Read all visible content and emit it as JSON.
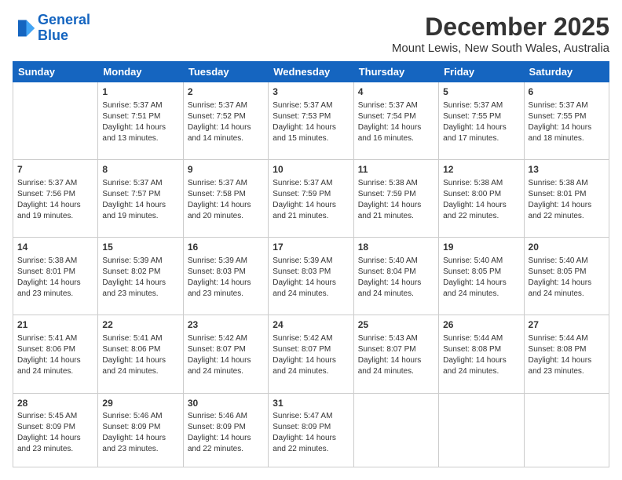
{
  "logo": {
    "line1": "General",
    "line2": "Blue"
  },
  "title": "December 2025",
  "location": "Mount Lewis, New South Wales, Australia",
  "weekdays": [
    "Sunday",
    "Monday",
    "Tuesday",
    "Wednesday",
    "Thursday",
    "Friday",
    "Saturday"
  ],
  "weeks": [
    [
      {
        "day": "",
        "text": ""
      },
      {
        "day": "1",
        "text": "Sunrise: 5:37 AM\nSunset: 7:51 PM\nDaylight: 14 hours\nand 13 minutes."
      },
      {
        "day": "2",
        "text": "Sunrise: 5:37 AM\nSunset: 7:52 PM\nDaylight: 14 hours\nand 14 minutes."
      },
      {
        "day": "3",
        "text": "Sunrise: 5:37 AM\nSunset: 7:53 PM\nDaylight: 14 hours\nand 15 minutes."
      },
      {
        "day": "4",
        "text": "Sunrise: 5:37 AM\nSunset: 7:54 PM\nDaylight: 14 hours\nand 16 minutes."
      },
      {
        "day": "5",
        "text": "Sunrise: 5:37 AM\nSunset: 7:55 PM\nDaylight: 14 hours\nand 17 minutes."
      },
      {
        "day": "6",
        "text": "Sunrise: 5:37 AM\nSunset: 7:55 PM\nDaylight: 14 hours\nand 18 minutes."
      }
    ],
    [
      {
        "day": "7",
        "text": "Sunrise: 5:37 AM\nSunset: 7:56 PM\nDaylight: 14 hours\nand 19 minutes."
      },
      {
        "day": "8",
        "text": "Sunrise: 5:37 AM\nSunset: 7:57 PM\nDaylight: 14 hours\nand 19 minutes."
      },
      {
        "day": "9",
        "text": "Sunrise: 5:37 AM\nSunset: 7:58 PM\nDaylight: 14 hours\nand 20 minutes."
      },
      {
        "day": "10",
        "text": "Sunrise: 5:37 AM\nSunset: 7:59 PM\nDaylight: 14 hours\nand 21 minutes."
      },
      {
        "day": "11",
        "text": "Sunrise: 5:38 AM\nSunset: 7:59 PM\nDaylight: 14 hours\nand 21 minutes."
      },
      {
        "day": "12",
        "text": "Sunrise: 5:38 AM\nSunset: 8:00 PM\nDaylight: 14 hours\nand 22 minutes."
      },
      {
        "day": "13",
        "text": "Sunrise: 5:38 AM\nSunset: 8:01 PM\nDaylight: 14 hours\nand 22 minutes."
      }
    ],
    [
      {
        "day": "14",
        "text": "Sunrise: 5:38 AM\nSunset: 8:01 PM\nDaylight: 14 hours\nand 23 minutes."
      },
      {
        "day": "15",
        "text": "Sunrise: 5:39 AM\nSunset: 8:02 PM\nDaylight: 14 hours\nand 23 minutes."
      },
      {
        "day": "16",
        "text": "Sunrise: 5:39 AM\nSunset: 8:03 PM\nDaylight: 14 hours\nand 23 minutes."
      },
      {
        "day": "17",
        "text": "Sunrise: 5:39 AM\nSunset: 8:03 PM\nDaylight: 14 hours\nand 24 minutes."
      },
      {
        "day": "18",
        "text": "Sunrise: 5:40 AM\nSunset: 8:04 PM\nDaylight: 14 hours\nand 24 minutes."
      },
      {
        "day": "19",
        "text": "Sunrise: 5:40 AM\nSunset: 8:05 PM\nDaylight: 14 hours\nand 24 minutes."
      },
      {
        "day": "20",
        "text": "Sunrise: 5:40 AM\nSunset: 8:05 PM\nDaylight: 14 hours\nand 24 minutes."
      }
    ],
    [
      {
        "day": "21",
        "text": "Sunrise: 5:41 AM\nSunset: 8:06 PM\nDaylight: 14 hours\nand 24 minutes."
      },
      {
        "day": "22",
        "text": "Sunrise: 5:41 AM\nSunset: 8:06 PM\nDaylight: 14 hours\nand 24 minutes."
      },
      {
        "day": "23",
        "text": "Sunrise: 5:42 AM\nSunset: 8:07 PM\nDaylight: 14 hours\nand 24 minutes."
      },
      {
        "day": "24",
        "text": "Sunrise: 5:42 AM\nSunset: 8:07 PM\nDaylight: 14 hours\nand 24 minutes."
      },
      {
        "day": "25",
        "text": "Sunrise: 5:43 AM\nSunset: 8:07 PM\nDaylight: 14 hours\nand 24 minutes."
      },
      {
        "day": "26",
        "text": "Sunrise: 5:44 AM\nSunset: 8:08 PM\nDaylight: 14 hours\nand 24 minutes."
      },
      {
        "day": "27",
        "text": "Sunrise: 5:44 AM\nSunset: 8:08 PM\nDaylight: 14 hours\nand 23 minutes."
      }
    ],
    [
      {
        "day": "28",
        "text": "Sunrise: 5:45 AM\nSunset: 8:09 PM\nDaylight: 14 hours\nand 23 minutes."
      },
      {
        "day": "29",
        "text": "Sunrise: 5:46 AM\nSunset: 8:09 PM\nDaylight: 14 hours\nand 23 minutes."
      },
      {
        "day": "30",
        "text": "Sunrise: 5:46 AM\nSunset: 8:09 PM\nDaylight: 14 hours\nand 22 minutes."
      },
      {
        "day": "31",
        "text": "Sunrise: 5:47 AM\nSunset: 8:09 PM\nDaylight: 14 hours\nand 22 minutes."
      },
      {
        "day": "",
        "text": ""
      },
      {
        "day": "",
        "text": ""
      },
      {
        "day": "",
        "text": ""
      }
    ]
  ]
}
